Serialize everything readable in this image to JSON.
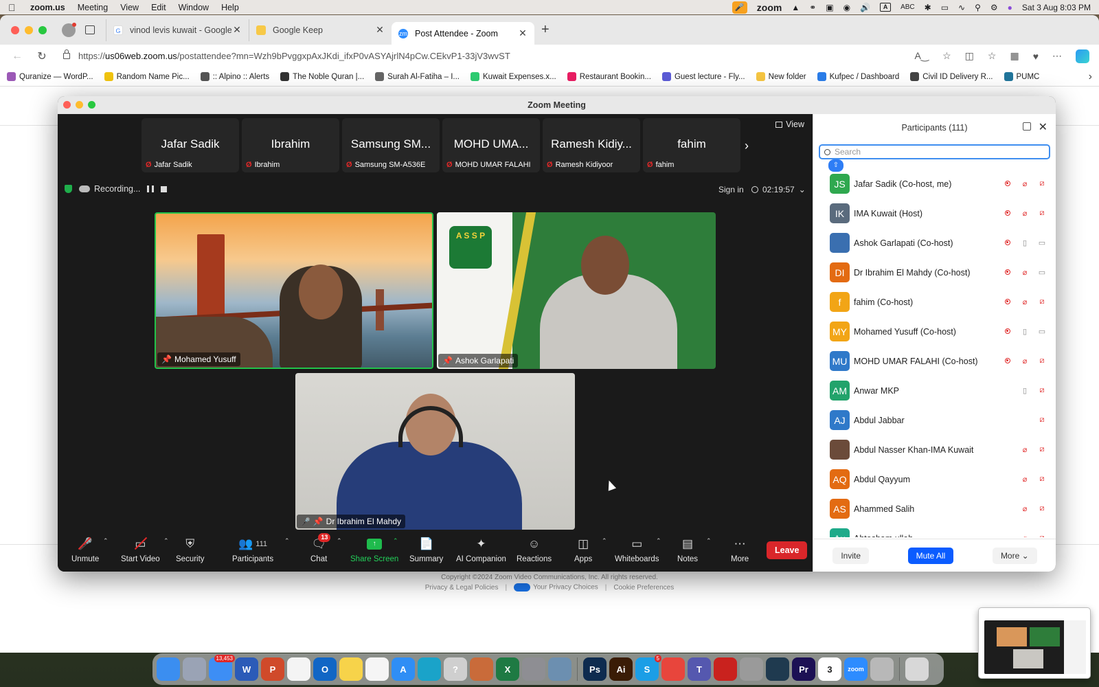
{
  "menubar": {
    "app": "zoom.us",
    "items": [
      "Meeting",
      "View",
      "Edit",
      "Window",
      "Help"
    ],
    "status_zoom": "zoom",
    "input_source": "ABC",
    "input_badge": "A",
    "datetime": "Sat 3 Aug  8:03 PM"
  },
  "browser": {
    "tabs": [
      {
        "title": "vinod levis kuwait - Google Se",
        "favicon": "google-icon"
      },
      {
        "title": "Google Keep",
        "favicon": "keep-icon"
      },
      {
        "title": "Post Attendee - Zoom",
        "favicon": "zoom-icon"
      }
    ],
    "url_host": "us06web.zoom.us",
    "url_prefix": "https://",
    "url_path": "/postattendee?mn=Wzh9bPvggxpAxJKdi_ifxP0vASYAjrlN4pCw.CEkvP1-33jV3wvST",
    "bookmarks": [
      {
        "label": "Quranize — WordP...",
        "color": "#9b59b6"
      },
      {
        "label": "Random Name Pic...",
        "color": "#f1c40f"
      },
      {
        "label": ":: Alpino :: Alerts",
        "color": "#555555"
      },
      {
        "label": "The Noble Quran |...",
        "color": "#333333"
      },
      {
        "label": "Surah Al-Fatiha – I...",
        "color": "#666666"
      },
      {
        "label": "Kuwait Expenses.x...",
        "color": "#2ecc71"
      },
      {
        "label": "Restaurant Bookin...",
        "color": "#e91e63"
      },
      {
        "label": "Guest lecture - Fly...",
        "color": "#5b5bd6"
      },
      {
        "label": "New folder",
        "color": "#f5c542"
      },
      {
        "label": "Kufpec / Dashboard",
        "color": "#2b7de9"
      },
      {
        "label": "Civil ID Delivery R...",
        "color": "#444444"
      },
      {
        "label": "PUMC",
        "color": "#21759b"
      }
    ]
  },
  "page_footer": {
    "copyright": "Copyright ©2024 Zoom Video Communications, Inc. All rights reserved.",
    "links": [
      "Privacy & Legal Policies",
      "Your Privacy Choices",
      "Cookie Preferences"
    ]
  },
  "zoom": {
    "window_title": "Zoom Meeting",
    "view_label": "View",
    "thumbnails": [
      {
        "display": "Jafar Sadik",
        "name": "Jafar Sadik"
      },
      {
        "display": "Ibrahim",
        "name": "Ibrahim"
      },
      {
        "display": "Samsung SM...",
        "name": "Samsung SM-A536E"
      },
      {
        "display": "MOHD UMA...",
        "name": "MOHD UMAR FALAHI"
      },
      {
        "display": "Ramesh Kidiy...",
        "name": "Ramesh Kidiyoor"
      },
      {
        "display": "fahim",
        "name": "fahim"
      }
    ],
    "recording_label": "Recording...",
    "sign_in": "Sign in",
    "timer": "02:19:57",
    "videos": [
      {
        "name": "Mohamed Yusuff"
      },
      {
        "name": "Ashok Garlapati"
      },
      {
        "name": "Dr Ibrahim El Mahdy"
      }
    ],
    "asp_logo_text": "A S S P",
    "toolbar": {
      "unmute": "Unmute",
      "start_video": "Start Video",
      "security": "Security",
      "participants": "Participants",
      "participants_count": "111",
      "chat": "Chat",
      "chat_badge": "13",
      "share_screen": "Share Screen",
      "summary": "Summary",
      "ai_companion": "AI Companion",
      "reactions": "Reactions",
      "apps": "Apps",
      "whiteboards": "Whiteboards",
      "notes": "Notes",
      "more": "More",
      "leave": "Leave"
    },
    "panel": {
      "title": "Participants (111)",
      "search_placeholder": "Search",
      "participants": [
        {
          "initials": "JS",
          "name": "Jafar Sadik (Co-host, me)",
          "color": "#2fa84f",
          "rec": true,
          "mic": "off",
          "video": "off"
        },
        {
          "initials": "IK",
          "name": "IMA Kuwait (Host)",
          "color": "#5a6b7d",
          "rec": true,
          "mic": "off",
          "video": "off"
        },
        {
          "initials": "",
          "name": "Ashok Garlapati (Co-host)",
          "color": "#3a6fb0",
          "rec": true,
          "mic": "on",
          "video": "on"
        },
        {
          "initials": "DI",
          "name": "Dr Ibrahim El Mahdy (Co-host)",
          "color": "#e36b12",
          "rec": true,
          "mic": "off",
          "video": "on"
        },
        {
          "initials": "f",
          "name": "fahim (Co-host)",
          "color": "#f2a516",
          "rec": true,
          "mic": "off",
          "video": "off"
        },
        {
          "initials": "MY",
          "name": "Mohamed Yusuff (Co-host)",
          "color": "#f2a516",
          "rec": true,
          "mic": "on",
          "video": "on"
        },
        {
          "initials": "MU",
          "name": "MOHD UMAR FALAHI (Co-host)",
          "color": "#2f79c9",
          "rec": true,
          "mic": "off",
          "video": "off"
        },
        {
          "initials": "AM",
          "name": "Anwar MKP",
          "color": "#22a36b",
          "rec": false,
          "mic": "on",
          "video": "off"
        },
        {
          "initials": "AJ",
          "name": "Abdul Jabbar",
          "color": "#2f79c9",
          "rec": false,
          "mic": "none",
          "video": "off"
        },
        {
          "initials": "",
          "name": "Abdul Nasser Khan-IMA Kuwait",
          "color": "#6b4b3a",
          "rec": false,
          "mic": "off",
          "video": "off"
        },
        {
          "initials": "AQ",
          "name": "Abdul Qayyum",
          "color": "#e36b12",
          "rec": false,
          "mic": "off",
          "video": "off"
        },
        {
          "initials": "AS",
          "name": "Ahammed Salih",
          "color": "#e36b12",
          "rec": false,
          "mic": "off",
          "video": "off"
        },
        {
          "initials": "Au",
          "name": "Ahtesham ullah",
          "color": "#1faa8a",
          "rec": false,
          "mic": "off",
          "video": "off"
        }
      ],
      "invite": "Invite",
      "mute_all": "Mute All",
      "more": "More"
    }
  },
  "dock": {
    "apps": [
      {
        "name": "finder-icon",
        "color": "#3b8ef0",
        "label": ""
      },
      {
        "name": "launchpad-icon",
        "color": "#9aa3b5",
        "label": ""
      },
      {
        "name": "mail-icon",
        "color": "#3d8ef5",
        "label": "",
        "badge": "13,453"
      },
      {
        "name": "word-icon",
        "color": "#2b5bb8",
        "label": "W"
      },
      {
        "name": "powerpoint-icon",
        "color": "#d04a2a",
        "label": "P"
      },
      {
        "name": "reminders-icon",
        "color": "#f4f4f4",
        "label": ""
      },
      {
        "name": "outlook-icon",
        "color": "#1166c5",
        "label": "O"
      },
      {
        "name": "notes-icon",
        "color": "#f7d34a",
        "label": ""
      },
      {
        "name": "freeform-icon",
        "color": "#f5f5f5",
        "label": ""
      },
      {
        "name": "app-store-icon",
        "color": "#2f8ef5",
        "label": "A"
      },
      {
        "name": "edge-icon",
        "color": "#1aa3c9",
        "label": ""
      },
      {
        "name": "help-icon",
        "color": "#cfcfcf",
        "label": "?"
      },
      {
        "name": "preview-icon",
        "color": "#c96b3a",
        "label": ""
      },
      {
        "name": "excel-icon",
        "color": "#1e7a43",
        "label": "X"
      },
      {
        "name": "settings-icon",
        "color": "#8e8e93",
        "label": ""
      },
      {
        "name": "photo-icon",
        "color": "#6c8fb0",
        "label": ""
      },
      {
        "name": "photoshop-icon",
        "color": "#0e2b4f",
        "label": "Ps"
      },
      {
        "name": "illustrator-icon",
        "color": "#3a1c06",
        "label": "Ai"
      },
      {
        "name": "skype-icon",
        "color": "#1b9ee6",
        "label": "S",
        "badge": "5"
      },
      {
        "name": "chrome-icon",
        "color": "#e8453c",
        "label": ""
      },
      {
        "name": "teams-icon",
        "color": "#5558af",
        "label": "T"
      },
      {
        "name": "acrobat-icon",
        "color": "#c9221e",
        "label": ""
      },
      {
        "name": "whatsapp-icon",
        "color": "#9a9a9a",
        "label": ""
      },
      {
        "name": "filmora-icon",
        "color": "#1f3a4f",
        "label": ""
      },
      {
        "name": "premiere-icon",
        "color": "#1c1054",
        "label": "Pr"
      },
      {
        "name": "calendar-icon",
        "color": "#ffffff",
        "label": "3"
      },
      {
        "name": "zoom-icon",
        "color": "#2d8cff",
        "label": "zoom"
      },
      {
        "name": "document-icon",
        "color": "#b8b8b8",
        "label": ""
      },
      {
        "name": "trash-icon",
        "color": "#d8d8d8",
        "label": ""
      }
    ]
  }
}
